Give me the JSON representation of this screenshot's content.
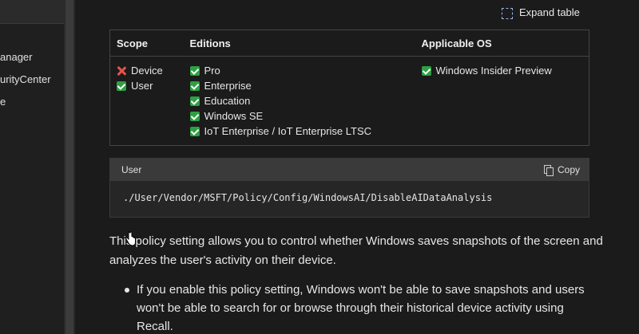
{
  "sidebar": {
    "items": [
      "anager",
      "urityCenter",
      "e"
    ]
  },
  "expand_table": {
    "label": "Expand table",
    "icon": "expand-icon"
  },
  "table": {
    "headers": [
      "Scope",
      "Editions",
      "Applicable OS"
    ],
    "scope": [
      {
        "label": "Device",
        "status": "no"
      },
      {
        "label": "User",
        "status": "yes"
      }
    ],
    "editions": [
      "Pro",
      "Enterprise",
      "Education",
      "Windows SE",
      "IoT Enterprise / IoT Enterprise LTSC"
    ],
    "os": [
      "Windows Insider Preview"
    ]
  },
  "code": {
    "lang_label": "User",
    "copy_label": "Copy",
    "content": "./User/Vendor/MSFT/Policy/Config/WindowsAI/DisableAIDataAnalysis"
  },
  "description": "This policy setting allows you to control whether Windows saves snapshots of the screen and analyzes the user's activity on their device.",
  "bullet": "If you enable this policy setting, Windows won't be able to save snapshots and users won't be able to search for or browse through their historical device activity using Recall.",
  "colors": {
    "check": "#2ea043",
    "cross": "#e5534b",
    "background": "#1b1b1b"
  }
}
